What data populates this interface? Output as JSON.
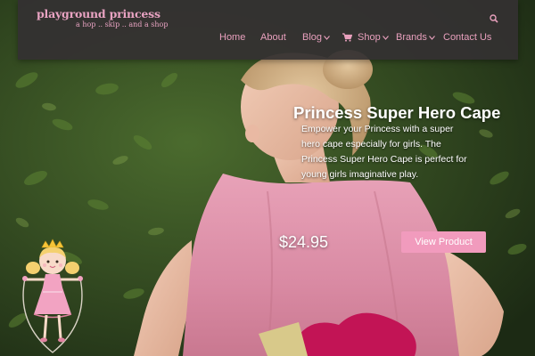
{
  "brand": {
    "name": "playground princess",
    "tagline": "a hop .. skip .. and a shop"
  },
  "nav": {
    "items": [
      {
        "label": "Home",
        "has_dropdown": false
      },
      {
        "label": "About",
        "has_dropdown": false
      },
      {
        "label": "Blog",
        "has_dropdown": true
      },
      {
        "label": "Shop",
        "has_dropdown": true,
        "icon": "cart-icon"
      },
      {
        "label": "Brands",
        "has_dropdown": true
      },
      {
        "label": "Contact Us",
        "has_dropdown": false
      }
    ],
    "search_icon": "search-icon"
  },
  "hero": {
    "title": "Princess Super Hero Cape",
    "description": "Empower your Princess with a super hero cape especially for girls. The Princess Super Hero Cape is perfect for young girls imaginative play.",
    "price": "$24.95",
    "button_label": "View Product"
  },
  "colors": {
    "accent_pink": "#f19bbd",
    "nav_text": "#e8a0bd",
    "header_bg": "#343031"
  }
}
